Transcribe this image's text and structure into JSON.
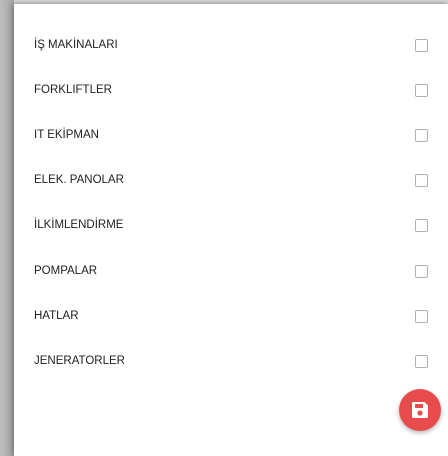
{
  "categories": [
    {
      "label": "İŞ MAKİNALARI",
      "checked": false
    },
    {
      "label": "FORKLIFTLER",
      "checked": false
    },
    {
      "label": "IT EKİPMAN",
      "checked": false
    },
    {
      "label": "ELEK. PANOLAR",
      "checked": false
    },
    {
      "label": "İLKİMLENDİRME",
      "checked": false
    },
    {
      "label": "POMPALAR",
      "checked": false
    },
    {
      "label": "HATLAR",
      "checked": false
    },
    {
      "label": "JENERATORLER",
      "checked": false
    }
  ],
  "save_button": {
    "icon": "floppy-disk-icon",
    "color": "#e84b4b"
  }
}
